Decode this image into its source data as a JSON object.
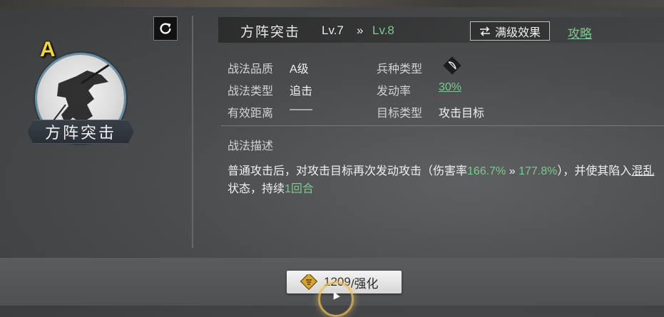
{
  "skill": {
    "grade": "A",
    "name": "方阵突击",
    "level_current": "Lv.7",
    "level_arrow": "»",
    "level_next": "Lv.8",
    "max_effect_label": "满级效果",
    "guide_label": "攻略"
  },
  "attributes": {
    "quality_label": "战法品质",
    "quality_value": "A级",
    "troop_label": "兵种类型",
    "type_label": "战法类型",
    "type_value": "追击",
    "rate_label": "发动率",
    "rate_value": "30%",
    "range_label": "有效距离",
    "range_value": "——",
    "target_label": "目标类型",
    "target_value": "攻击目标"
  },
  "description": {
    "title": "战法描述",
    "part1": "普通攻击后，对攻击目标再次发动攻击（伤害率",
    "dmg_from": "166.7%",
    "dmg_arrow": " » ",
    "dmg_to": "177.8%",
    "part2": "），并使其陷入",
    "status": "混乱",
    "part3": "状态，持续",
    "duration": "1回合"
  },
  "enhance_button": {
    "cost": "1209",
    "label": "/强化"
  },
  "icons": {
    "refresh": "refresh-icon",
    "swap": "swap-icon",
    "troop": "bow-icon",
    "coin": "coin-icon"
  },
  "colors": {
    "accent_green": "#7cc98e",
    "grade_gold": "#f4d43b"
  }
}
